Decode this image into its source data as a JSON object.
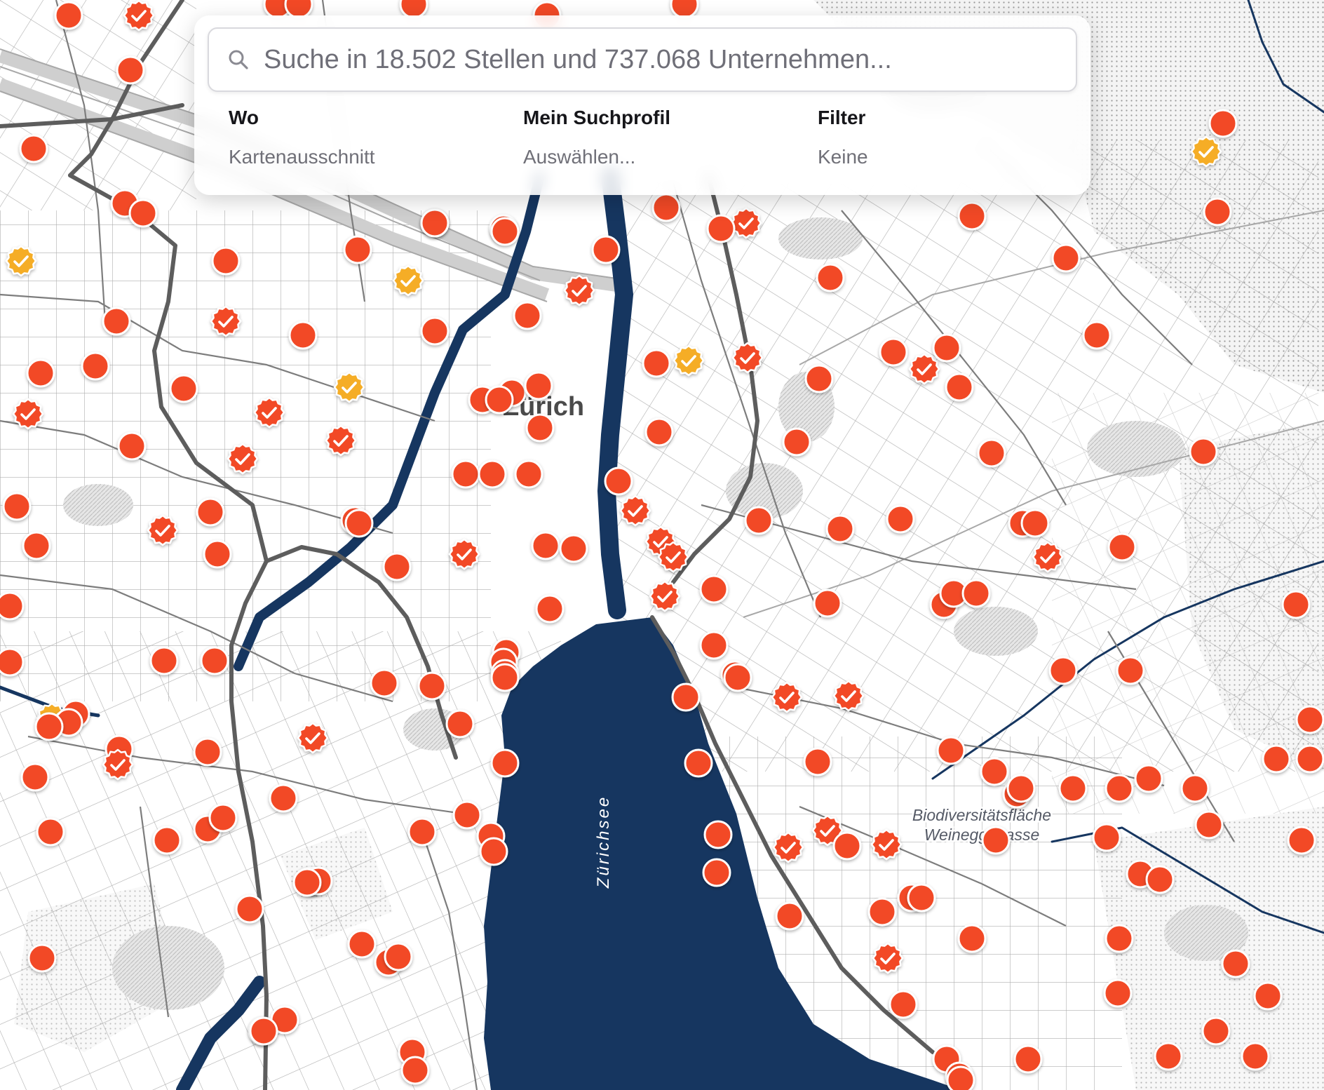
{
  "search": {
    "placeholder": "Suche in 18.502 Stellen und 737.068 Unternehmen..."
  },
  "tabs": [
    {
      "label": "Wo",
      "value": "Kartenausschnitt"
    },
    {
      "label": "Mein Suchprofil",
      "value": "Auswählen..."
    },
    {
      "label": "Filter",
      "value": "Keine"
    }
  ],
  "map": {
    "city_label": "Zürich",
    "lake_label": "Zürichsee",
    "poi_label_line1": "Biodiversitätsfläche",
    "poi_label_line2": "Weineggstrasse",
    "colors": {
      "water": "#163660",
      "marker": "#f24a27",
      "marker_verified_featured": "#f5ad26",
      "road_major": "#5d5d5d",
      "road_minor": "#777777",
      "park": "#dedede"
    },
    "marker_icon": "map-pin-dot",
    "verified_icon": "checkmark-badge-icon"
  }
}
